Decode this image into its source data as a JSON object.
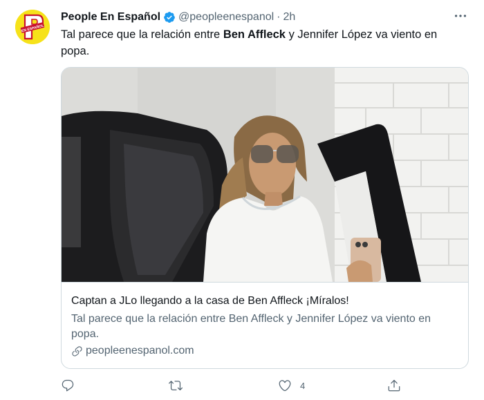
{
  "author": {
    "display_name": "People En Español",
    "handle": "@peopleenespanol",
    "separator": "·",
    "time": "2h",
    "avatar_icon": "people-en-espanol-logo",
    "avatar_color": "#f6e21a",
    "logo_text": "EN ESPAÑOL"
  },
  "tweet": {
    "text_before": "Tal parece que la relación entre ",
    "text_bold": "Ben Affleck",
    "text_after": " y Jennifer López va viento en popa."
  },
  "card": {
    "image_icon": "photo-jennifer-lopez-car",
    "title": "Captan a JLo llegando a la casa de Ben Affleck ¡Míralos!",
    "description": "Tal parece que la relación entre Ben Affleck y Jennifer López va viento en popa.",
    "domain": "peopleenespanol.com"
  },
  "actions": {
    "reply_icon": "reply-icon",
    "retweet_icon": "retweet-icon",
    "like_icon": "heart-icon",
    "like_count": "4",
    "share_icon": "share-icon"
  },
  "colors": {
    "verified": "#1d9bf0",
    "secondary_text": "#536471",
    "border": "#cfd9de"
  }
}
